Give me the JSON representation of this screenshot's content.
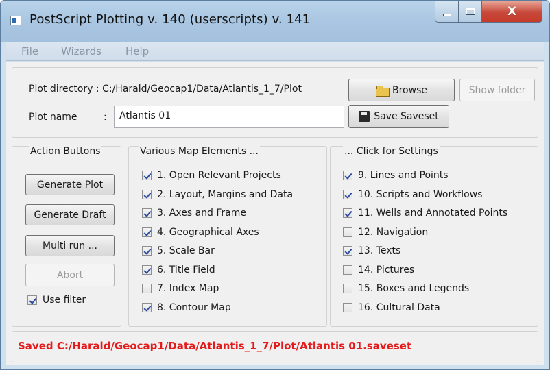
{
  "window": {
    "title": "PostScript Plotting v. 140 (userscripts) v. 141"
  },
  "menu": [
    "File",
    "Wizards",
    "Help"
  ],
  "plot": {
    "dir_label": "Plot directory : C:/Harald/Geocap1/Data/Atlantis_1_7/Plot",
    "name_label": "Plot name",
    "name_colon": ":",
    "name_value": "Atlantis 01",
    "browse": "Browse",
    "show_folder": "Show folder",
    "save_saveset": "Save Saveset"
  },
  "action_group": {
    "title": "Action Buttons",
    "generate_plot": "Generate Plot",
    "generate_draft": "Generate Draft",
    "multi_run": "Multi run ...",
    "abort": "Abort",
    "use_filter": {
      "label": "Use filter",
      "checked": true
    }
  },
  "map_elements": {
    "title": "Various Map Elements ...",
    "items": [
      {
        "label": "1. Open Relevant Projects",
        "checked": true
      },
      {
        "label": "2. Layout, Margins and Data",
        "checked": true
      },
      {
        "label": "3. Axes and Frame",
        "checked": true
      },
      {
        "label": "4. Geographical Axes",
        "checked": true
      },
      {
        "label": "5. Scale Bar",
        "checked": true
      },
      {
        "label": "6. Title Field",
        "checked": true
      },
      {
        "label": "7. Index Map",
        "checked": false
      },
      {
        "label": "8. Contour Map",
        "checked": true
      }
    ]
  },
  "settings": {
    "title": "... Click for Settings",
    "items": [
      {
        "label": "9. Lines and Points",
        "checked": true
      },
      {
        "label": "10. Scripts and Workflows",
        "checked": true
      },
      {
        "label": "11. Wells and Annotated Points",
        "checked": true
      },
      {
        "label": "12. Navigation",
        "checked": false
      },
      {
        "label": "13. Texts",
        "checked": true
      },
      {
        "label": "14. Pictures",
        "checked": false
      },
      {
        "label": "15. Boxes and Legends",
        "checked": false
      },
      {
        "label": "16. Cultural Data",
        "checked": false
      }
    ]
  },
  "status": {
    "text": "Saved C:/Harald/Geocap1/Data/Atlantis_1_7/Plot/Atlantis 01.saveset",
    "color": "#e51b1b"
  }
}
